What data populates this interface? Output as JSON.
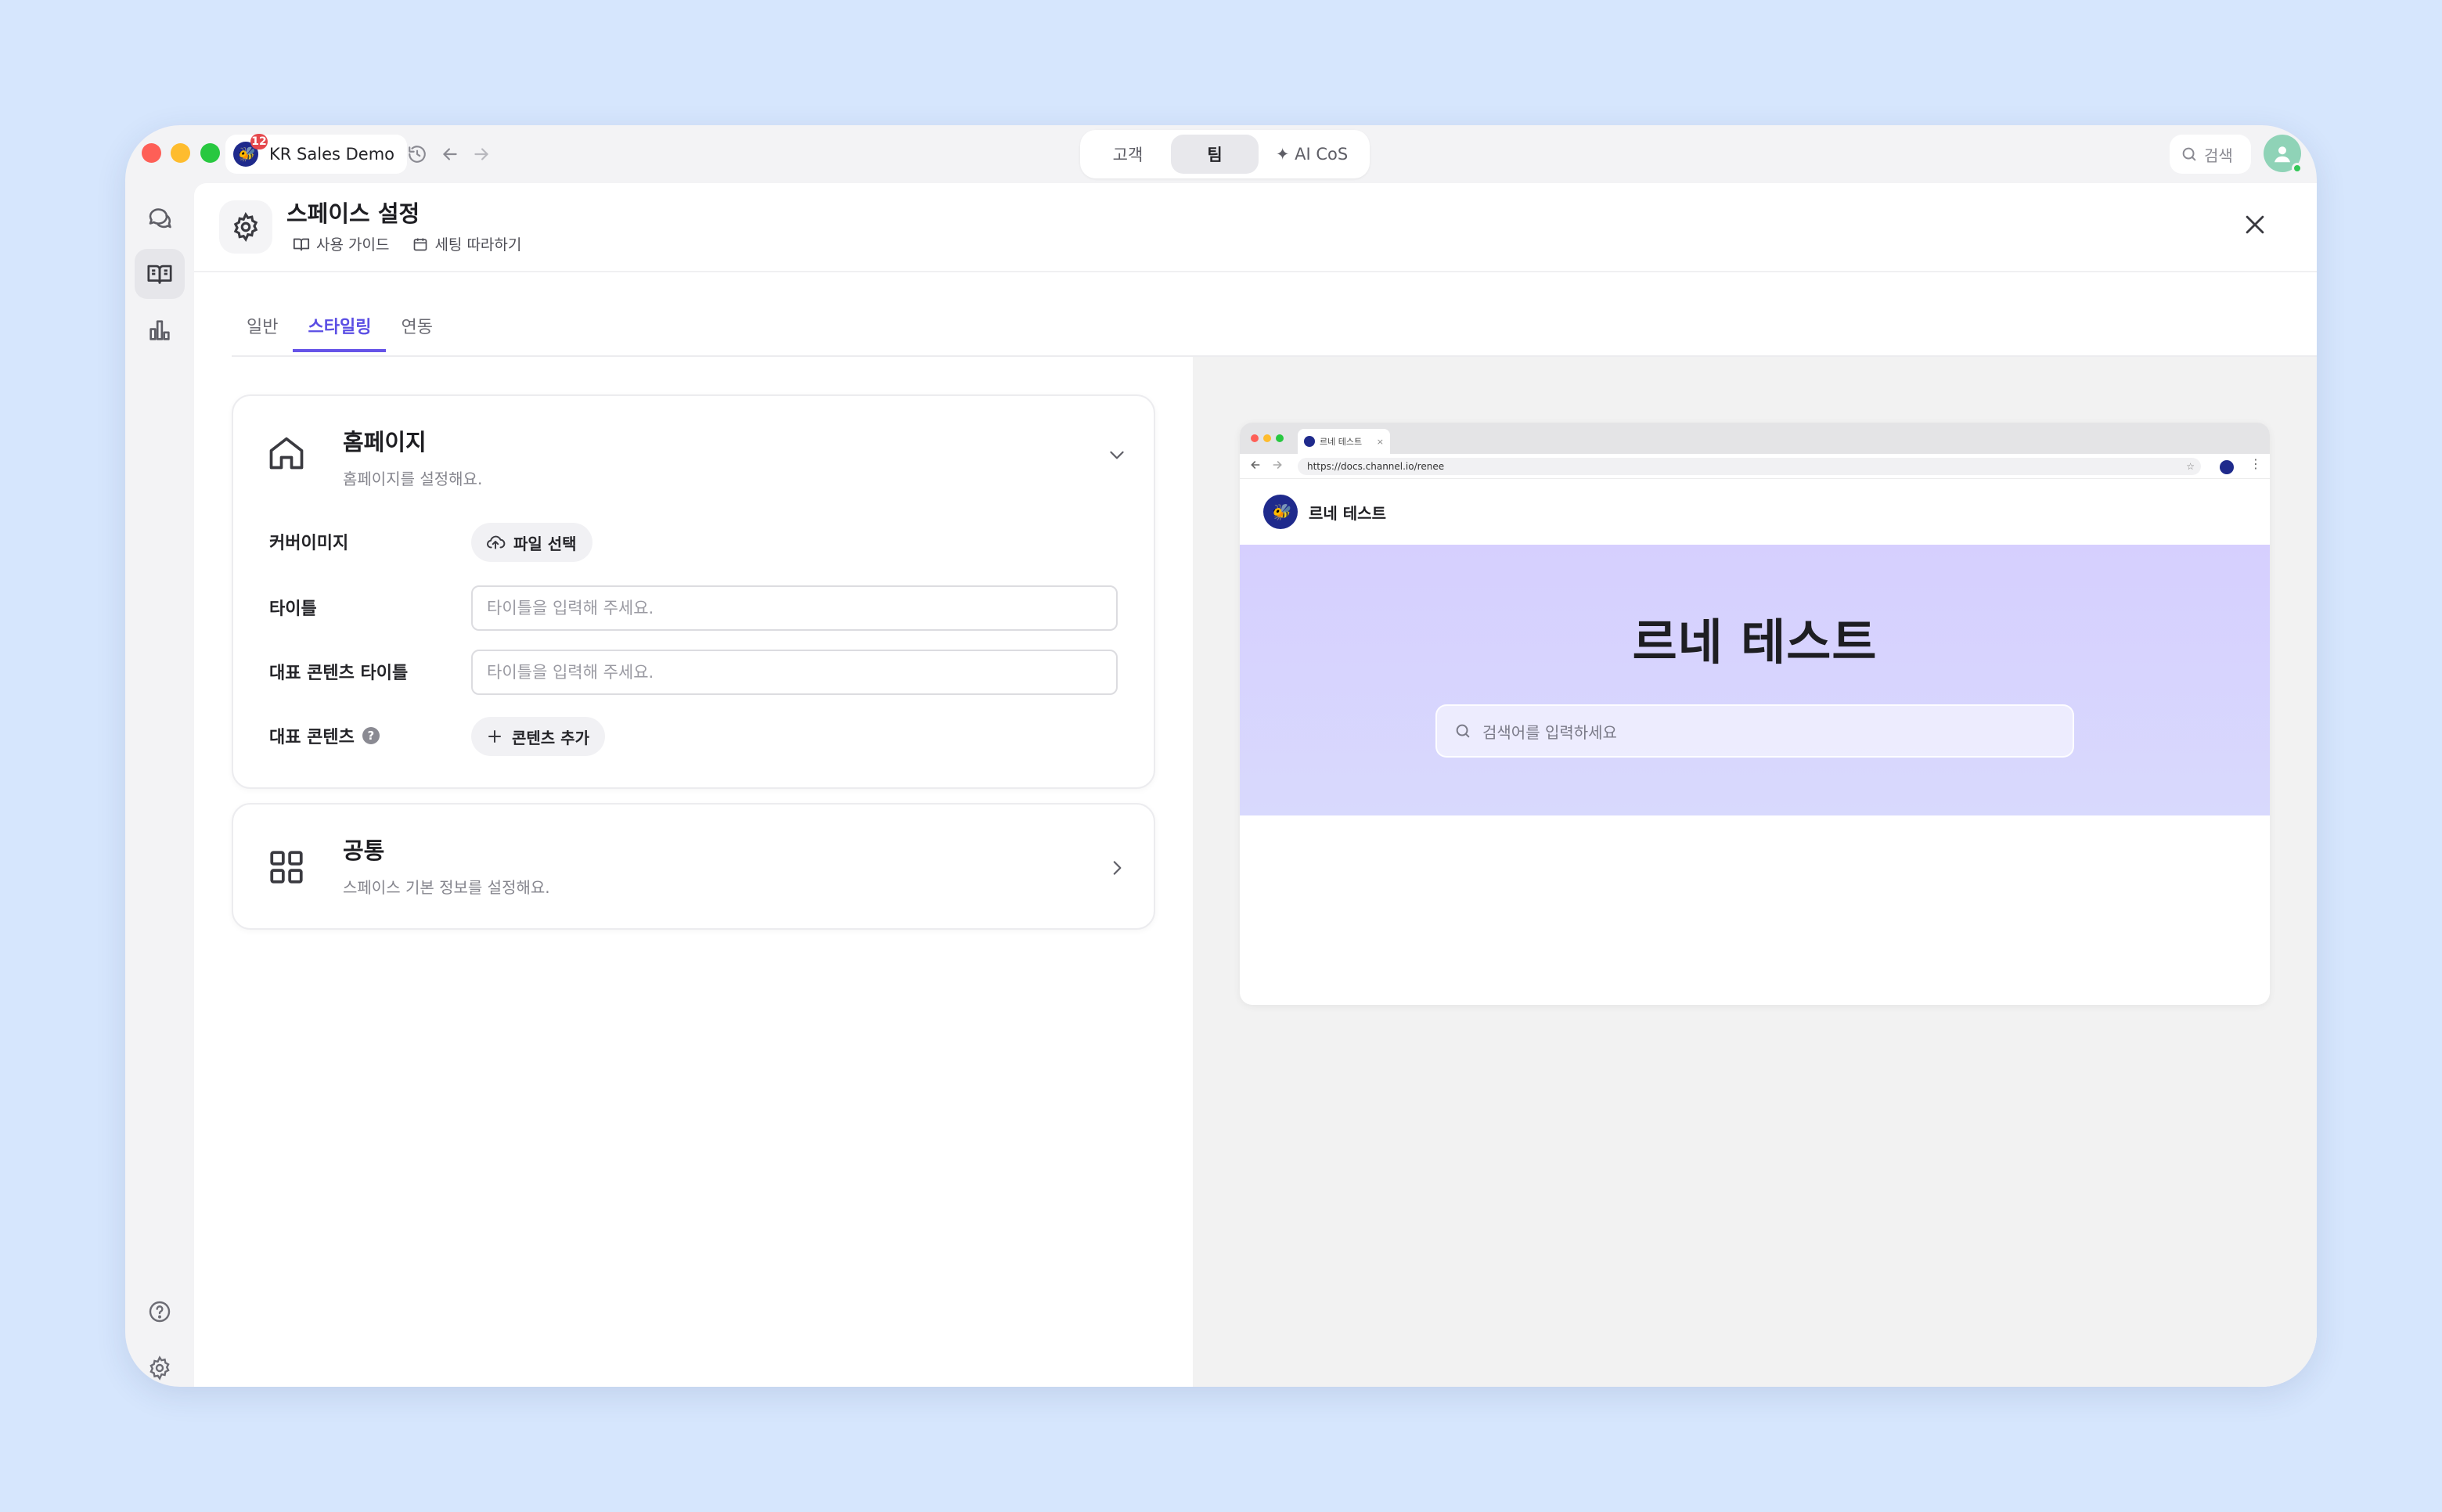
{
  "window": {
    "workspace_name": "KR Sales Demo",
    "workspace_badge": "12",
    "workspace_logo_glyph": "🐝",
    "segments": [
      "고객",
      "팀",
      "✦ AI CoS"
    ],
    "search_label": "검색"
  },
  "header": {
    "title": "스페이스 설정",
    "links": [
      "사용 가이드",
      "세팅 따라하기"
    ]
  },
  "tabs": [
    "일반",
    "스타일링",
    "연동"
  ],
  "homepage_card": {
    "title": "홈페이지",
    "description": "홈페이지를 설정해요.",
    "rows": {
      "cover_label": "커버이미지",
      "cover_button": "파일 선택",
      "title_label": "타이틀",
      "title_placeholder": "타이틀을 입력해 주세요.",
      "featured_title_label": "대표 콘텐츠 타이틀",
      "featured_title_placeholder": "타이틀을 입력해 주세요.",
      "featured_label": "대표 콘텐츠",
      "featured_help": "?",
      "featured_button": "콘텐츠 추가"
    }
  },
  "common_card": {
    "title": "공통",
    "description": "스페이스 기본 정보를 설정해요."
  },
  "preview": {
    "tab_title": "르네 테스트",
    "url": "https://docs.channel.io/renee",
    "brand_name": "르네 테스트",
    "hero_title": "르네 테스트",
    "search_placeholder": "검색어를 입력하세요"
  },
  "colors": {
    "accent": "#6654e8",
    "hero_from": "#d6cffe",
    "hero_to": "#d8d9fd",
    "desktop": "#d6e6fd"
  }
}
